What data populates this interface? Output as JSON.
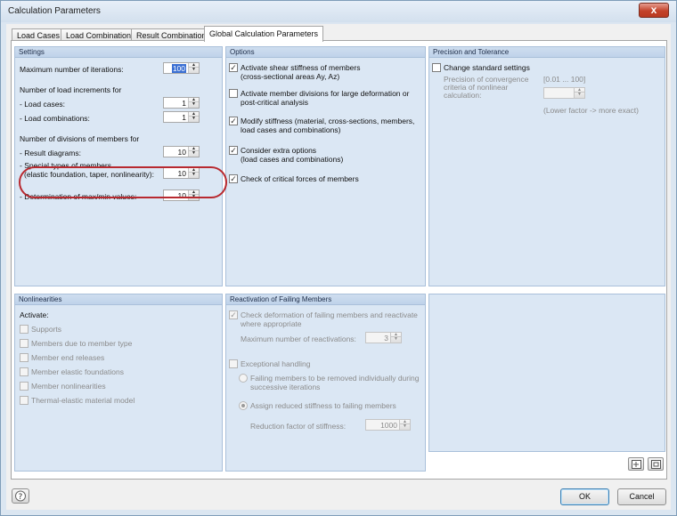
{
  "window": {
    "title": "Calculation Parameters",
    "close_glyph": "x"
  },
  "tabs": [
    {
      "label": "Load Cases"
    },
    {
      "label": "Load Combinations"
    },
    {
      "label": "Result Combinations"
    },
    {
      "label": "Global Calculation Parameters",
      "active": true
    }
  ],
  "settings": {
    "header": "Settings",
    "max_iterations_label": "Maximum number of iterations:",
    "max_iterations_value": "100",
    "load_increments_heading": "Number of load increments for",
    "load_cases_label": "- Load cases:",
    "load_cases_value": "1",
    "load_combinations_label": "- Load combinations:",
    "load_combinations_value": "1",
    "divisions_heading": "Number of divisions of members for",
    "result_diagrams_label": "- Result diagrams:",
    "result_diagrams_value": "10",
    "special_types_label_1": "- Special types of members",
    "special_types_label_2": "(elastic foundation, taper, nonlinearity):",
    "special_types_value": "10",
    "maxmin_label": "- Determination of max/min values:",
    "maxmin_value": "10"
  },
  "options": {
    "header": "Options",
    "items": [
      {
        "line1": "Activate shear stiffness of members",
        "line2": "(cross-sectional areas Ay, Az)",
        "checked": true
      },
      {
        "line1": "Activate member divisions for large deformation or",
        "line2": "post-critical analysis",
        "checked": false
      },
      {
        "line1": "Modify stiffness (material, cross-sections, members,",
        "line2": "load cases and combinations)",
        "checked": true
      },
      {
        "line1": "Consider extra options",
        "line2": "(load cases and combinations)",
        "checked": true
      },
      {
        "line1": "Check of critical forces of members",
        "line2": "",
        "checked": true
      }
    ]
  },
  "precision": {
    "header": "Precision and Tolerance",
    "change_label": "Change standard settings",
    "criteria_1": "Precision of convergence",
    "criteria_2": "criteria of nonlinear",
    "criteria_3": "calculation:",
    "range": "[0.01 ... 100]",
    "hint": "(Lower factor -> more exact)"
  },
  "nonlinearities": {
    "header": "Nonlinearities",
    "activate_label": "Activate:",
    "items": [
      "Supports",
      "Members due to member type",
      "Member end releases",
      "Member elastic foundations",
      "Member nonlinearities",
      "Thermal-elastic material model"
    ]
  },
  "reactivation": {
    "header": "Reactivation of Failing Members",
    "check_line1": "Check deformation of failing members and reactivate",
    "check_line2": "where appropriate",
    "max_reactivations_label": "Maximum number of reactivations:",
    "max_reactivations_value": "3",
    "exceptional_label": "Exceptional handling",
    "radio1_line1": "Failing members to be removed individually during",
    "radio1_line2": "successive iterations",
    "radio2_label": "Assign reduced stiffness to failing members",
    "reduction_label": "Reduction factor of stiffness:",
    "reduction_value": "1000"
  },
  "footer": {
    "ok_label": "OK",
    "cancel_label": "Cancel"
  },
  "colors": {
    "accent": "#3a6fd3",
    "highlight_ellipse": "#b8292f",
    "panel_bg": "#dbe7f4"
  }
}
